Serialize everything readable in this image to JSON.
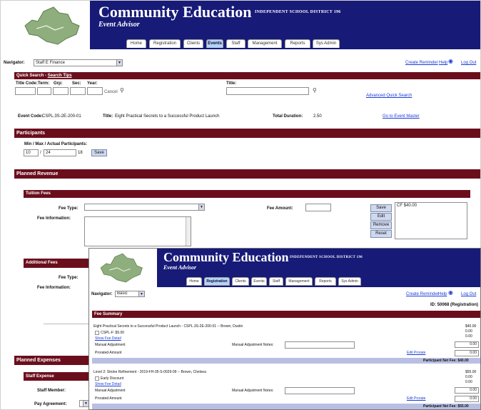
{
  "brand": {
    "title": "Community Education",
    "district": "INDEPENDENT SCHOOL DISTRICT 196",
    "subtitle": "Event Advisor",
    "colors": {
      "header": "#171a77",
      "section_bar": "#6b0e1c",
      "active_tab": "#b5d2f5",
      "link": "#1a3bd6"
    }
  },
  "tabs": [
    "Home",
    "Registration",
    "Clients",
    "Events",
    "Staff",
    "Management",
    "Reports",
    "Sys Admin"
  ],
  "shot1": {
    "active_tab": "Events",
    "navigator": {
      "label": "Navigator:",
      "value": "Staff E Finance"
    },
    "toplinks": {
      "create": "Create Reminder",
      "help": "Help",
      "logout": "Log Out"
    },
    "quick_search": {
      "bar": "Quick Search -",
      "tips": "Search Tips",
      "headers": [
        "Title Code:",
        "Term:",
        "Grp:",
        "Sec:",
        "Year:"
      ],
      "title_label": "Title:",
      "cancel": "Cancel",
      "advanced": "Advanced Quick Search"
    },
    "event": {
      "code_label": "Event Code:",
      "code": "CSPL.3S-2E-200-01",
      "title_label": "Title:",
      "title": "Eight Practical Secrets to a Successful Product Launch",
      "duration_label": "Total Duration:",
      "duration": "2.50",
      "goto": "Go to Event Master"
    },
    "participants": {
      "bar": "Participants",
      "label": "Min / Max / Actual Participants:",
      "min": "10",
      "max": "24",
      "actual": "18",
      "save": "Save"
    },
    "planned_revenue": "Planned Revenue",
    "tuition": {
      "bar": "Tuition Fees",
      "fee_type": "Fee Type:",
      "fee_information": "Fee Information:",
      "fee_amount": "Fee Amount:",
      "list_value": "CF $40.00",
      "buttons": [
        "Save",
        "Edit",
        "Remove",
        "Reset"
      ]
    },
    "additional": {
      "bar": "Additional Fees",
      "fee_type": "Fee Type:",
      "fee_information": "Fee Information:"
    },
    "planned_expenses": {
      "bar": "Planned Expenses",
      "staff_bar": "Staff Expense",
      "staff_member": "Staff Member:",
      "pay_agreement": "Pay Agreement:"
    }
  },
  "shot2": {
    "active_tab": "Registration",
    "navigator": {
      "label": "Navigator:",
      "value": "Basic"
    },
    "toplinks": {
      "create": "Create Reminder",
      "help": "Help",
      "logout": "Log Out"
    },
    "registration_id": "ID: 50068 (Registration)",
    "fee_summary": "Fee Summary",
    "entries": [
      {
        "title": "Eight Practical Secrets to a Successful Product Launch - CSPL.3S-2E-200-01 -- Brown, Dustin",
        "check_label": "CSPL-F: $5.00",
        "link": "Show Fee Detail",
        "manual_adjustment": "Manual Adjustment",
        "notes_label": "Manual Adjustment Notes:",
        "prorated": "Prorated Amount",
        "edit": "Edit Prorate",
        "amounts": [
          "$40.00",
          "0.00",
          "0.00",
          "0.00",
          "0.00"
        ],
        "net_label": "Participant Net Fee: $40.00"
      },
      {
        "title": "Level 2: Stroke Refinement - 2019-FH-35-S-0029-09 -- Brown, Chelsea",
        "check_label": "Early Discount",
        "link": "Show Fee Detail",
        "manual_adjustment": "Manual Adjustment",
        "notes_label": "Manual Adjustment Notes:",
        "prorated": "Prorated Amount",
        "edit": "Edit Prorate",
        "amounts": [
          "$55.00",
          "0.00",
          "0.00",
          "0.00",
          "0.00"
        ],
        "net_label": "Participant Net Fee: $55.00"
      }
    ]
  }
}
